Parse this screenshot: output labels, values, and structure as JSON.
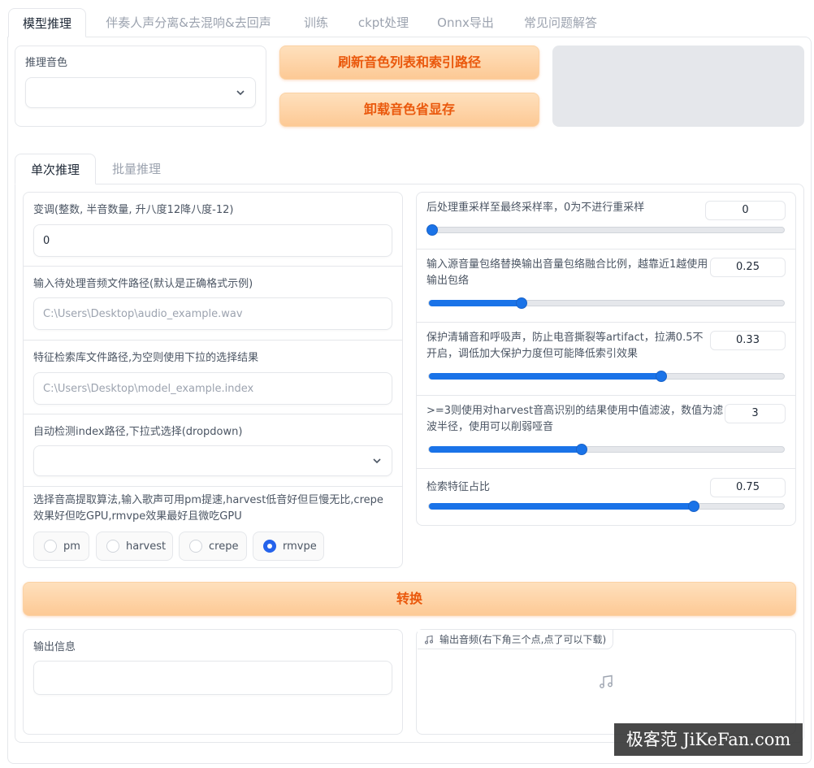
{
  "top_tabs": [
    "模型推理",
    "伴奏人声分离&去混响&去回声",
    "训练",
    "ckpt处理",
    "Onnx导出",
    "常见问题解答"
  ],
  "voice_select": {
    "label": "推理音色",
    "value": ""
  },
  "buttons": {
    "refresh": "刷新音色列表和索引路径",
    "unload": "卸载音色省显存",
    "convert": "转换"
  },
  "sub_tabs": [
    "单次推理",
    "批量推理"
  ],
  "left": {
    "transpose": {
      "label": "变调(整数, 半音数量, 升八度12降八度-12)",
      "value": "0"
    },
    "input_path": {
      "label": "输入待处理音频文件路径(默认是正确格式示例)",
      "placeholder": "C:\\Users\\Desktop\\audio_example.wav"
    },
    "index_path": {
      "label": "特征检索库文件路径,为空则使用下拉的选择结果",
      "placeholder": "C:\\Users\\Desktop\\model_example.index"
    },
    "index_dropdown": {
      "label": "自动检测index路径,下拉式选择(dropdown)",
      "value": ""
    },
    "f0_method": {
      "label": "选择音高提取算法,输入歌声可用pm提速,harvest低音好但巨慢无比,crepe效果好但吃GPU,rmvpe效果最好且微吃GPU",
      "options": [
        "pm",
        "harvest",
        "crepe",
        "rmvpe"
      ],
      "selected": "rmvpe"
    }
  },
  "right": {
    "resample": {
      "label": "后处理重采样至最终采样率，0为不进行重采样",
      "value": "0",
      "fraction": 0.0
    },
    "rms_mix": {
      "label": "输入源音量包络替换输出音量包络融合比例，越靠近1越使用输出包络",
      "value": "0.25",
      "fraction": 0.25
    },
    "protect": {
      "label": "保护清辅音和呼吸声，防止电音撕裂等artifact，拉满0.5不开启，调低加大保护力度但可能降低索引效果",
      "value": "0.33",
      "fraction": 0.66
    },
    "filter_radius": {
      "label": ">=3则使用对harvest音高识别的结果使用中值滤波，数值为滤波半径，使用可以削弱哑音",
      "value": "3",
      "fraction": 0.43
    },
    "index_rate": {
      "label": "检索特征占比",
      "value": "0.75",
      "fraction": 0.75
    }
  },
  "output": {
    "info_label": "输出信息",
    "info_value": "",
    "audio_label": "输出音频(右下角三个点,点了可以下载)"
  },
  "watermark": "极客范 JiKeFan.com",
  "colors": {
    "accent": "#1a73e8",
    "button_text": "#ea580c"
  }
}
